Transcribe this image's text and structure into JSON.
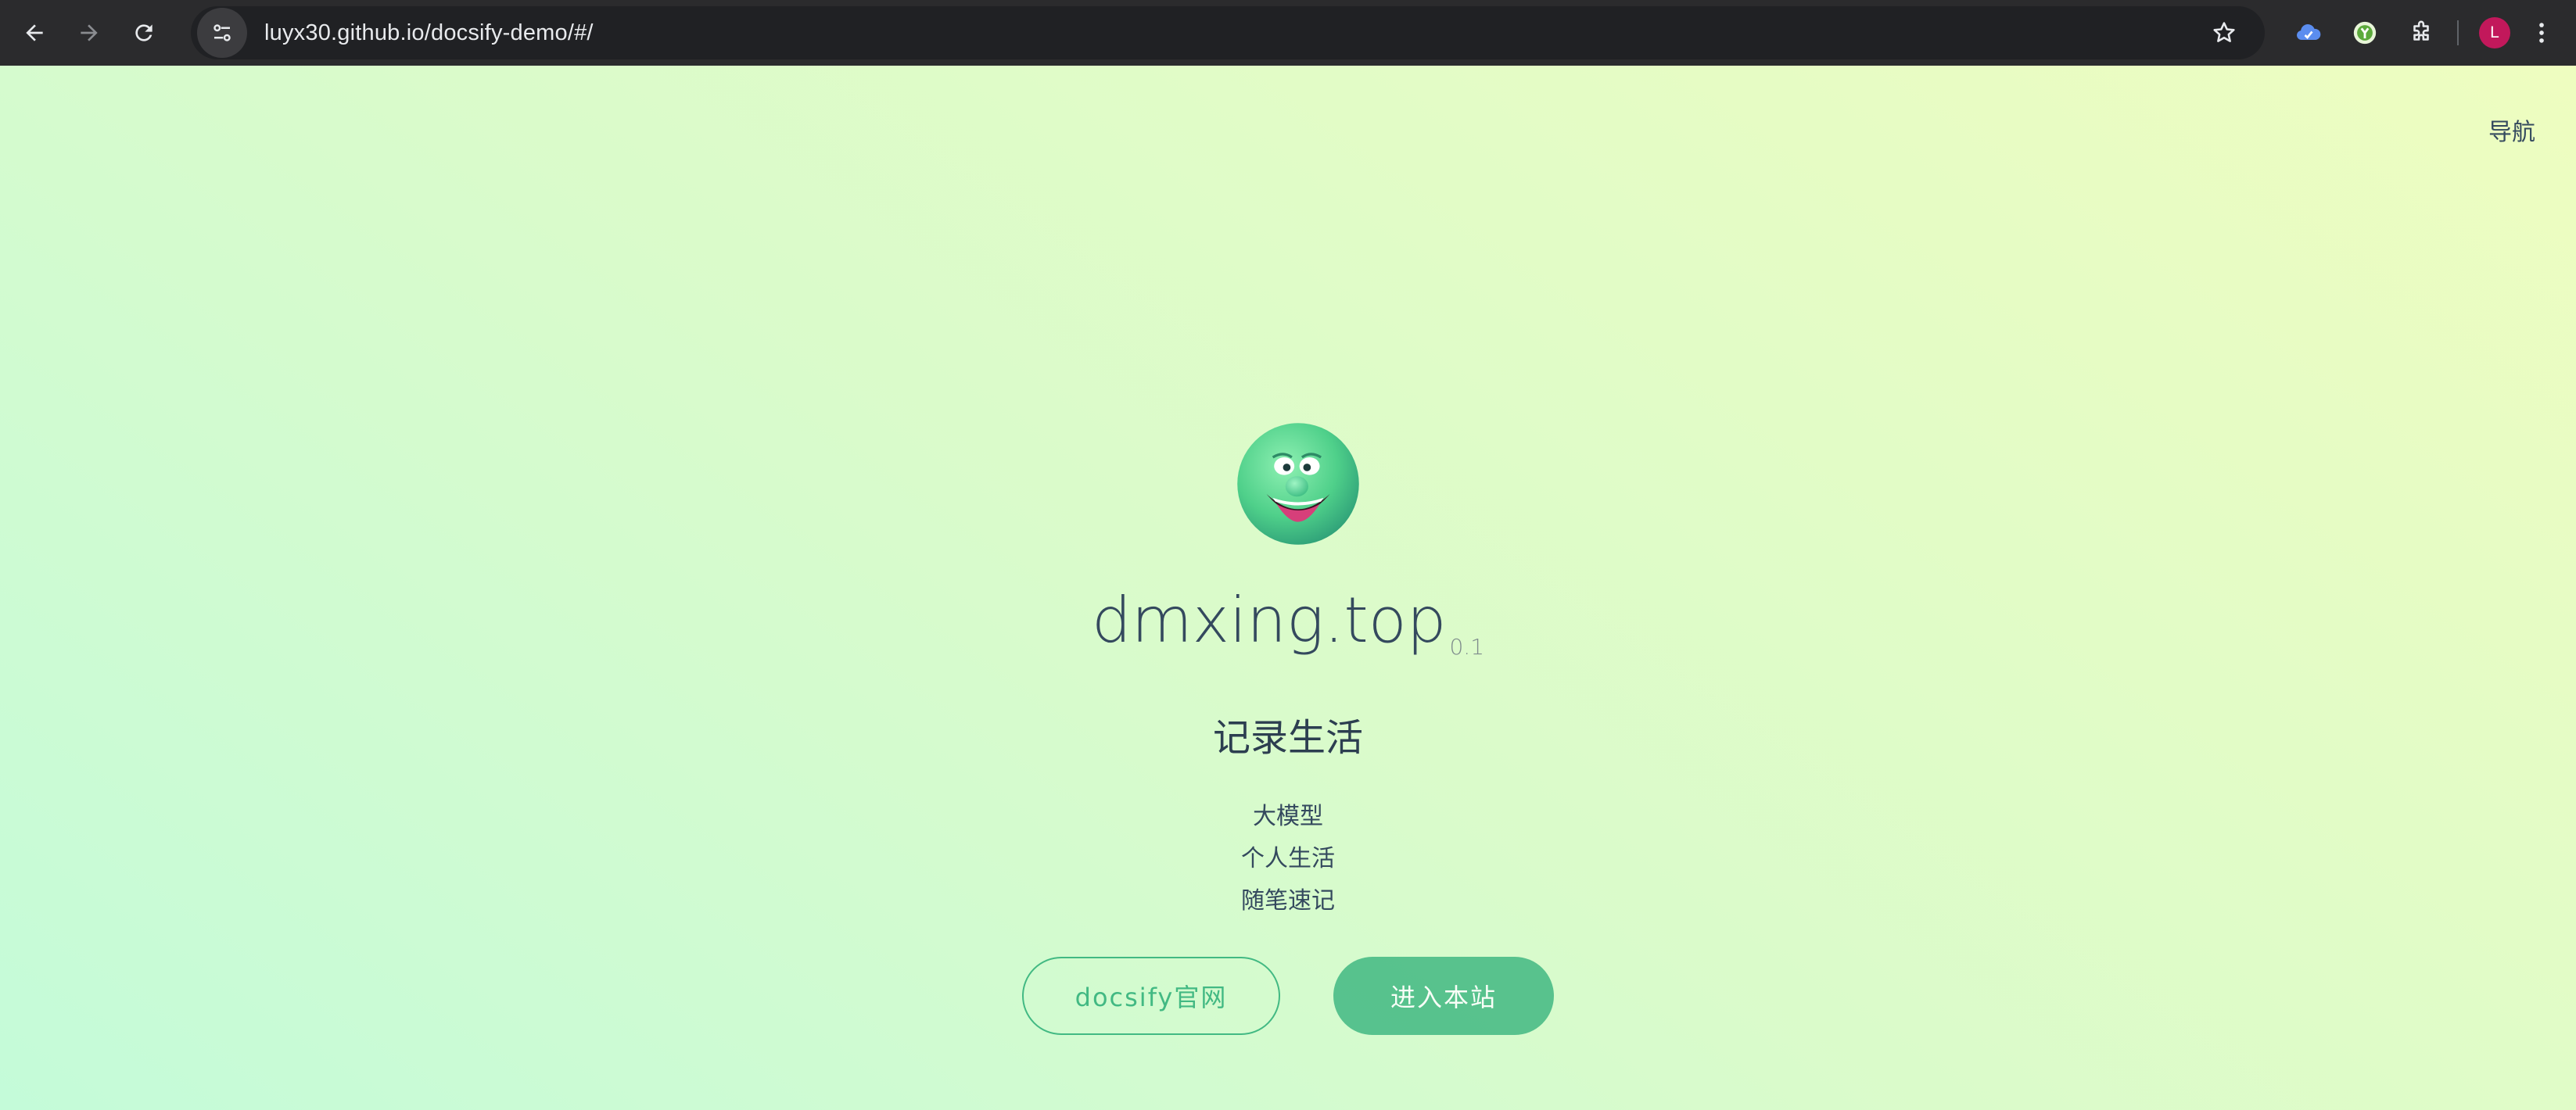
{
  "browser": {
    "url": "luyx30.github.io/docsify-demo/#/",
    "profile_initial": "L",
    "profile_color": "#c2185b",
    "icons": {
      "back": "arrow-left-icon",
      "forward": "arrow-right-icon",
      "reload": "reload-icon",
      "site_info": "tune-icon",
      "bookmark": "star-icon",
      "extensions": [
        "cloud-extension-icon",
        "green-extension-icon",
        "puzzle-icon"
      ],
      "menu": "kebab-menu-icon"
    }
  },
  "page": {
    "nav_label": "导航",
    "title": "dmxing.top",
    "version": "0.1",
    "tagline": "记录生活",
    "features": [
      "大模型",
      "个人生活",
      "随笔速记"
    ],
    "buttons": {
      "docsify_label": "docsify官网",
      "enter_label": "进入本站"
    },
    "theme_color": "#42b983",
    "text_color": "#34495e"
  }
}
